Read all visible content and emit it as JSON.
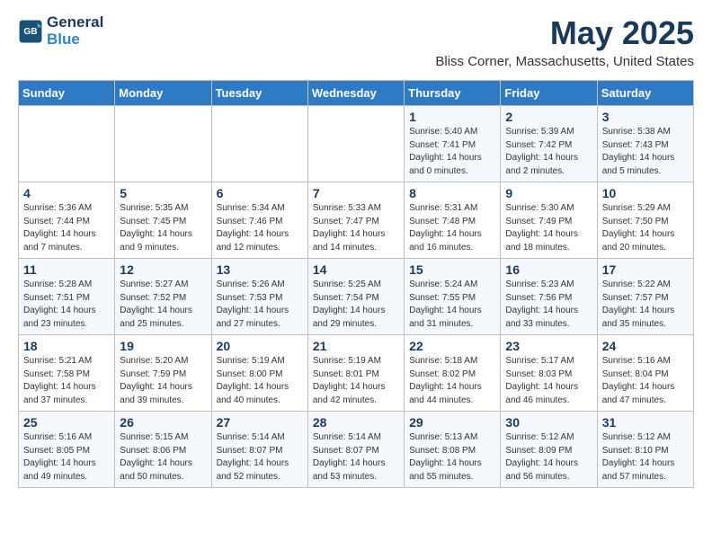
{
  "header": {
    "logo_line1": "General",
    "logo_line2": "Blue",
    "month_title": "May 2025",
    "location": "Bliss Corner, Massachusetts, United States"
  },
  "weekdays": [
    "Sunday",
    "Monday",
    "Tuesday",
    "Wednesday",
    "Thursday",
    "Friday",
    "Saturday"
  ],
  "weeks": [
    [
      {
        "day": "",
        "info": ""
      },
      {
        "day": "",
        "info": ""
      },
      {
        "day": "",
        "info": ""
      },
      {
        "day": "",
        "info": ""
      },
      {
        "day": "1",
        "info": "Sunrise: 5:40 AM\nSunset: 7:41 PM\nDaylight: 14 hours\nand 0 minutes."
      },
      {
        "day": "2",
        "info": "Sunrise: 5:39 AM\nSunset: 7:42 PM\nDaylight: 14 hours\nand 2 minutes."
      },
      {
        "day": "3",
        "info": "Sunrise: 5:38 AM\nSunset: 7:43 PM\nDaylight: 14 hours\nand 5 minutes."
      }
    ],
    [
      {
        "day": "4",
        "info": "Sunrise: 5:36 AM\nSunset: 7:44 PM\nDaylight: 14 hours\nand 7 minutes."
      },
      {
        "day": "5",
        "info": "Sunrise: 5:35 AM\nSunset: 7:45 PM\nDaylight: 14 hours\nand 9 minutes."
      },
      {
        "day": "6",
        "info": "Sunrise: 5:34 AM\nSunset: 7:46 PM\nDaylight: 14 hours\nand 12 minutes."
      },
      {
        "day": "7",
        "info": "Sunrise: 5:33 AM\nSunset: 7:47 PM\nDaylight: 14 hours\nand 14 minutes."
      },
      {
        "day": "8",
        "info": "Sunrise: 5:31 AM\nSunset: 7:48 PM\nDaylight: 14 hours\nand 16 minutes."
      },
      {
        "day": "9",
        "info": "Sunrise: 5:30 AM\nSunset: 7:49 PM\nDaylight: 14 hours\nand 18 minutes."
      },
      {
        "day": "10",
        "info": "Sunrise: 5:29 AM\nSunset: 7:50 PM\nDaylight: 14 hours\nand 20 minutes."
      }
    ],
    [
      {
        "day": "11",
        "info": "Sunrise: 5:28 AM\nSunset: 7:51 PM\nDaylight: 14 hours\nand 23 minutes."
      },
      {
        "day": "12",
        "info": "Sunrise: 5:27 AM\nSunset: 7:52 PM\nDaylight: 14 hours\nand 25 minutes."
      },
      {
        "day": "13",
        "info": "Sunrise: 5:26 AM\nSunset: 7:53 PM\nDaylight: 14 hours\nand 27 minutes."
      },
      {
        "day": "14",
        "info": "Sunrise: 5:25 AM\nSunset: 7:54 PM\nDaylight: 14 hours\nand 29 minutes."
      },
      {
        "day": "15",
        "info": "Sunrise: 5:24 AM\nSunset: 7:55 PM\nDaylight: 14 hours\nand 31 minutes."
      },
      {
        "day": "16",
        "info": "Sunrise: 5:23 AM\nSunset: 7:56 PM\nDaylight: 14 hours\nand 33 minutes."
      },
      {
        "day": "17",
        "info": "Sunrise: 5:22 AM\nSunset: 7:57 PM\nDaylight: 14 hours\nand 35 minutes."
      }
    ],
    [
      {
        "day": "18",
        "info": "Sunrise: 5:21 AM\nSunset: 7:58 PM\nDaylight: 14 hours\nand 37 minutes."
      },
      {
        "day": "19",
        "info": "Sunrise: 5:20 AM\nSunset: 7:59 PM\nDaylight: 14 hours\nand 39 minutes."
      },
      {
        "day": "20",
        "info": "Sunrise: 5:19 AM\nSunset: 8:00 PM\nDaylight: 14 hours\nand 40 minutes."
      },
      {
        "day": "21",
        "info": "Sunrise: 5:19 AM\nSunset: 8:01 PM\nDaylight: 14 hours\nand 42 minutes."
      },
      {
        "day": "22",
        "info": "Sunrise: 5:18 AM\nSunset: 8:02 PM\nDaylight: 14 hours\nand 44 minutes."
      },
      {
        "day": "23",
        "info": "Sunrise: 5:17 AM\nSunset: 8:03 PM\nDaylight: 14 hours\nand 46 minutes."
      },
      {
        "day": "24",
        "info": "Sunrise: 5:16 AM\nSunset: 8:04 PM\nDaylight: 14 hours\nand 47 minutes."
      }
    ],
    [
      {
        "day": "25",
        "info": "Sunrise: 5:16 AM\nSunset: 8:05 PM\nDaylight: 14 hours\nand 49 minutes."
      },
      {
        "day": "26",
        "info": "Sunrise: 5:15 AM\nSunset: 8:06 PM\nDaylight: 14 hours\nand 50 minutes."
      },
      {
        "day": "27",
        "info": "Sunrise: 5:14 AM\nSunset: 8:07 PM\nDaylight: 14 hours\nand 52 minutes."
      },
      {
        "day": "28",
        "info": "Sunrise: 5:14 AM\nSunset: 8:07 PM\nDaylight: 14 hours\nand 53 minutes."
      },
      {
        "day": "29",
        "info": "Sunrise: 5:13 AM\nSunset: 8:08 PM\nDaylight: 14 hours\nand 55 minutes."
      },
      {
        "day": "30",
        "info": "Sunrise: 5:12 AM\nSunset: 8:09 PM\nDaylight: 14 hours\nand 56 minutes."
      },
      {
        "day": "31",
        "info": "Sunrise: 5:12 AM\nSunset: 8:10 PM\nDaylight: 14 hours\nand 57 minutes."
      }
    ]
  ]
}
